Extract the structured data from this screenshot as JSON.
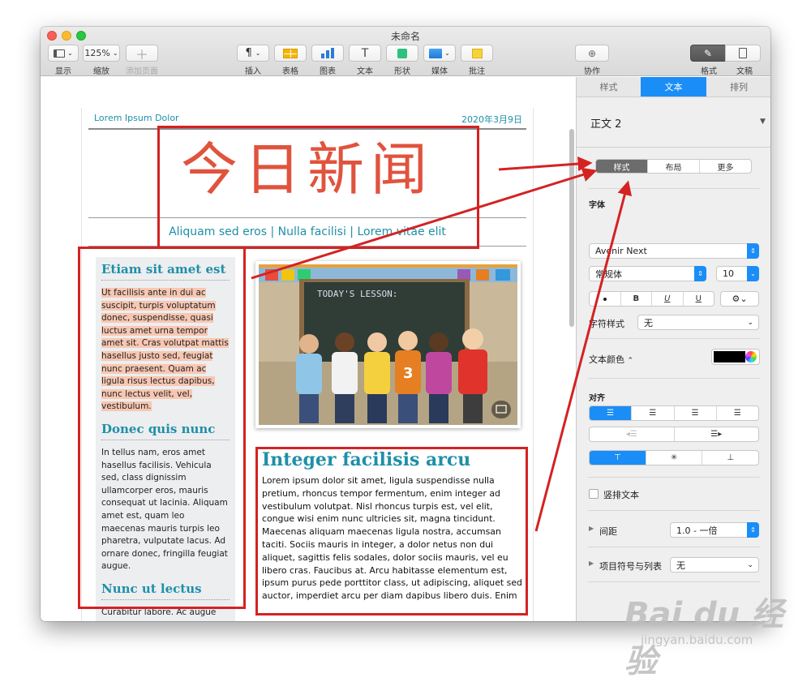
{
  "window": {
    "title": "未命名"
  },
  "toolbar": {
    "view": "显示",
    "zoom_value": "125%",
    "zoom": "缩放",
    "add_page": "添加页面",
    "insert": "插入",
    "table": "表格",
    "chart": "图表",
    "text": "文本",
    "shape": "形状",
    "media": "媒体",
    "comment": "批注",
    "collaborate": "协作",
    "format": "格式",
    "document": "文稿"
  },
  "doc": {
    "header_left": "Lorem Ipsum Dolor",
    "header_right": "2020年3月9日",
    "title": "今日新闻",
    "subtitle": "Aliquam sed eros | Nulla facilisi | Lorem vitae elit",
    "side_h1": "Etiam sit amet est",
    "side_p1": "Ut facilisis ante in dui ac suscipit, turpis voluptatum donec, suspendisse, quasi luctus amet urna tempor amet sit. Cras volutpat mattis hasellus justo sed, feugiat nunc praesent. Quam ac ligula risus lectus dapibus, nunc lectus velit, vel, vestibulum.",
    "side_h2": "Donec quis nunc",
    "side_p2": "In tellus nam, eros amet hasellus facilisis. Vehicula sed, class dignissim ullamcorper eros, mauris consequat ut lacinia. Aliquam amet est, quam leo maecenas mauris turpis leo pharetra, vulputate lacus. Ad ornare donec, fringilla feugiat augue.",
    "side_h3": "Nunc ut lectus",
    "side_p3": "Curabitur labore. Ac augue",
    "photo_board": "TODAY'S LESSON:",
    "article_title": "Integer facilisis arcu",
    "article_body": "Lorem ipsum dolor sit amet, ligula suspendisse nulla pretium, rhoncus tempor fermentum, enim integer ad vestibulum volutpat. Nisl rhoncus turpis est, vel elit, congue wisi enim nunc ultricies sit, magna tincidunt. Maecenas aliquam maecenas ligula nostra, accumsan taciti. Sociis mauris in integer, a dolor netus non dui aliquet, sagittis felis sodales, dolor sociis mauris, vel eu libero cras. Faucibus at. Arcu habitasse elementum est, ipsum purus pede porttitor class, ut adipiscing, aliquet sed auctor, imperdiet arcu per diam dapibus libero duis. Enim"
  },
  "sidebar": {
    "tabs": [
      "样式",
      "文本",
      "排列"
    ],
    "style_name": "正文 2",
    "subtabs": [
      "样式",
      "布局",
      "更多"
    ],
    "font_label": "字体",
    "font_name": "Avenir Next",
    "font_weight": "常规体",
    "font_size": "10",
    "char_style_label": "字符样式",
    "char_style_value": "无",
    "text_color_label": "文本颜色",
    "align_label": "对齐",
    "vertical_text": "竖排文本",
    "spacing_label": "间距",
    "spacing_value": "1.0 - 一倍",
    "bullets_label": "项目符号与列表",
    "bullets_value": "无"
  },
  "watermark": {
    "brand": "Bai du 经验",
    "url": "jingyan.baidu.com"
  },
  "colors": {
    "accent": "#1a8ef6",
    "heading_teal": "#1f8fa8",
    "title_red": "#e0533d",
    "annotation_red": "#d42222",
    "highlight": "#f8c7b2"
  }
}
